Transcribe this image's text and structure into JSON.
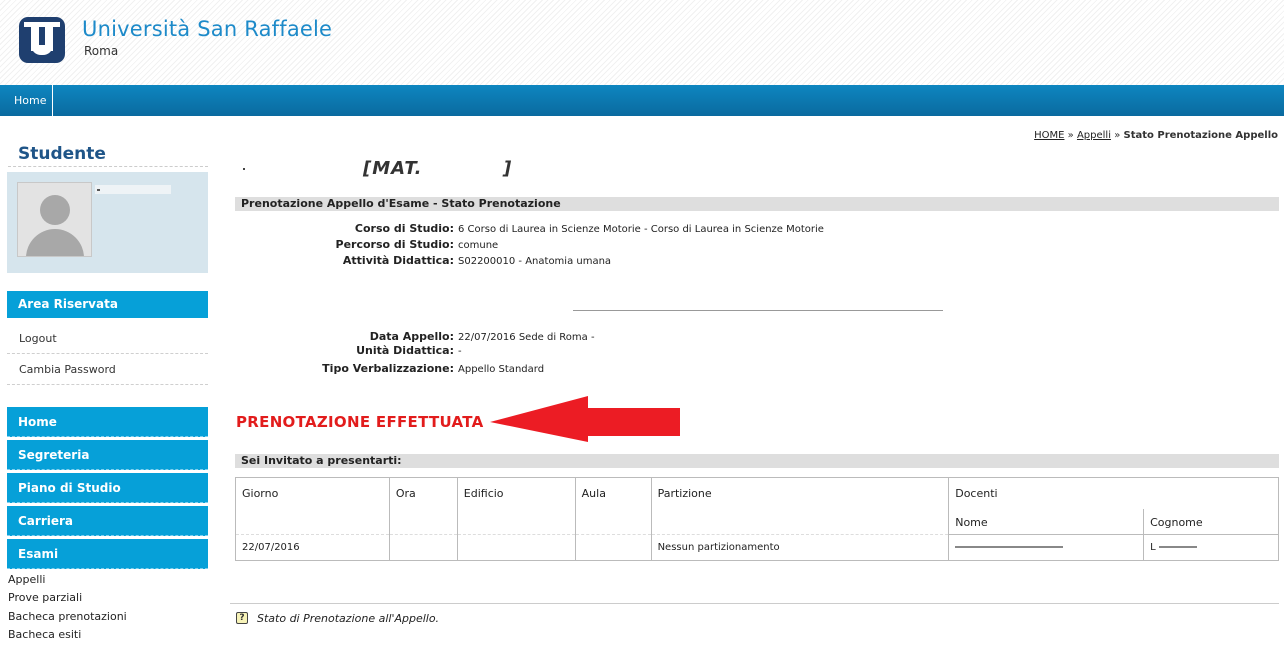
{
  "header": {
    "university": "Università San Raffaele",
    "city": "Roma"
  },
  "navbar": {
    "home": "Home"
  },
  "breadcrumb": {
    "home": "HOME",
    "sep1": "»",
    "appelli": "Appelli",
    "sep2": "»",
    "current": "Stato Prenotazione Appello"
  },
  "sidebar": {
    "title": "Studente",
    "area_riservata": "Area Riservata",
    "logout": "Logout",
    "cambia_password": "Cambia Password",
    "menu": [
      "Home",
      "Segreteria",
      "Piano di Studio",
      "Carriera",
      "Esami"
    ],
    "esami_sub": [
      "Appelli",
      "Prove parziali",
      "Bacheca prenotazioni",
      "Bacheca esiti"
    ]
  },
  "main": {
    "mat_label": "[MAT.",
    "mat_close": "]",
    "section1": "Prenotazione Appello d'Esame - Stato Prenotazione",
    "info1": [
      {
        "k": "Corso di Studio:",
        "v": "6 Corso di Laurea in Scienze Motorie - Corso di Laurea in Scienze Motorie"
      },
      {
        "k": "Percorso di Studio:",
        "v": "comune"
      },
      {
        "k": "Attività Didattica:",
        "v": "S02200010 - Anatomia umana"
      }
    ],
    "info2": [
      {
        "k": "Data Appello:",
        "v": "22/07/2016 Sede di Roma -"
      },
      {
        "k": "Unità Didattica:",
        "v": "-"
      },
      {
        "k": "Tipo Verbalizzazione:",
        "v": "Appello Standard"
      }
    ],
    "status": "PRENOTAZIONE EFFETTUATA",
    "section2": "Sei Invitato a presentarti:",
    "table": {
      "headers": [
        "Giorno",
        "Ora",
        "Edificio",
        "Aula",
        "Partizione",
        "Docenti"
      ],
      "sub_headers": [
        "Nome",
        "Cognome"
      ],
      "row": {
        "giorno": "22/07/2016",
        "ora": "",
        "edificio": "",
        "aula": "",
        "partizione": "Nessun partizionamento",
        "cognome_initial": "L"
      }
    },
    "footer_help": "?",
    "footer_text": "Stato di Prenotazione all'Appello."
  },
  "colors": {
    "accent": "#06a0d8",
    "navbar": "#0a76ae",
    "status": "#e21c1c",
    "title": "#1d8ac9"
  },
  "icons": [
    "university-logo-icon",
    "avatar-placeholder-icon",
    "red-arrow-icon",
    "help-icon"
  ]
}
